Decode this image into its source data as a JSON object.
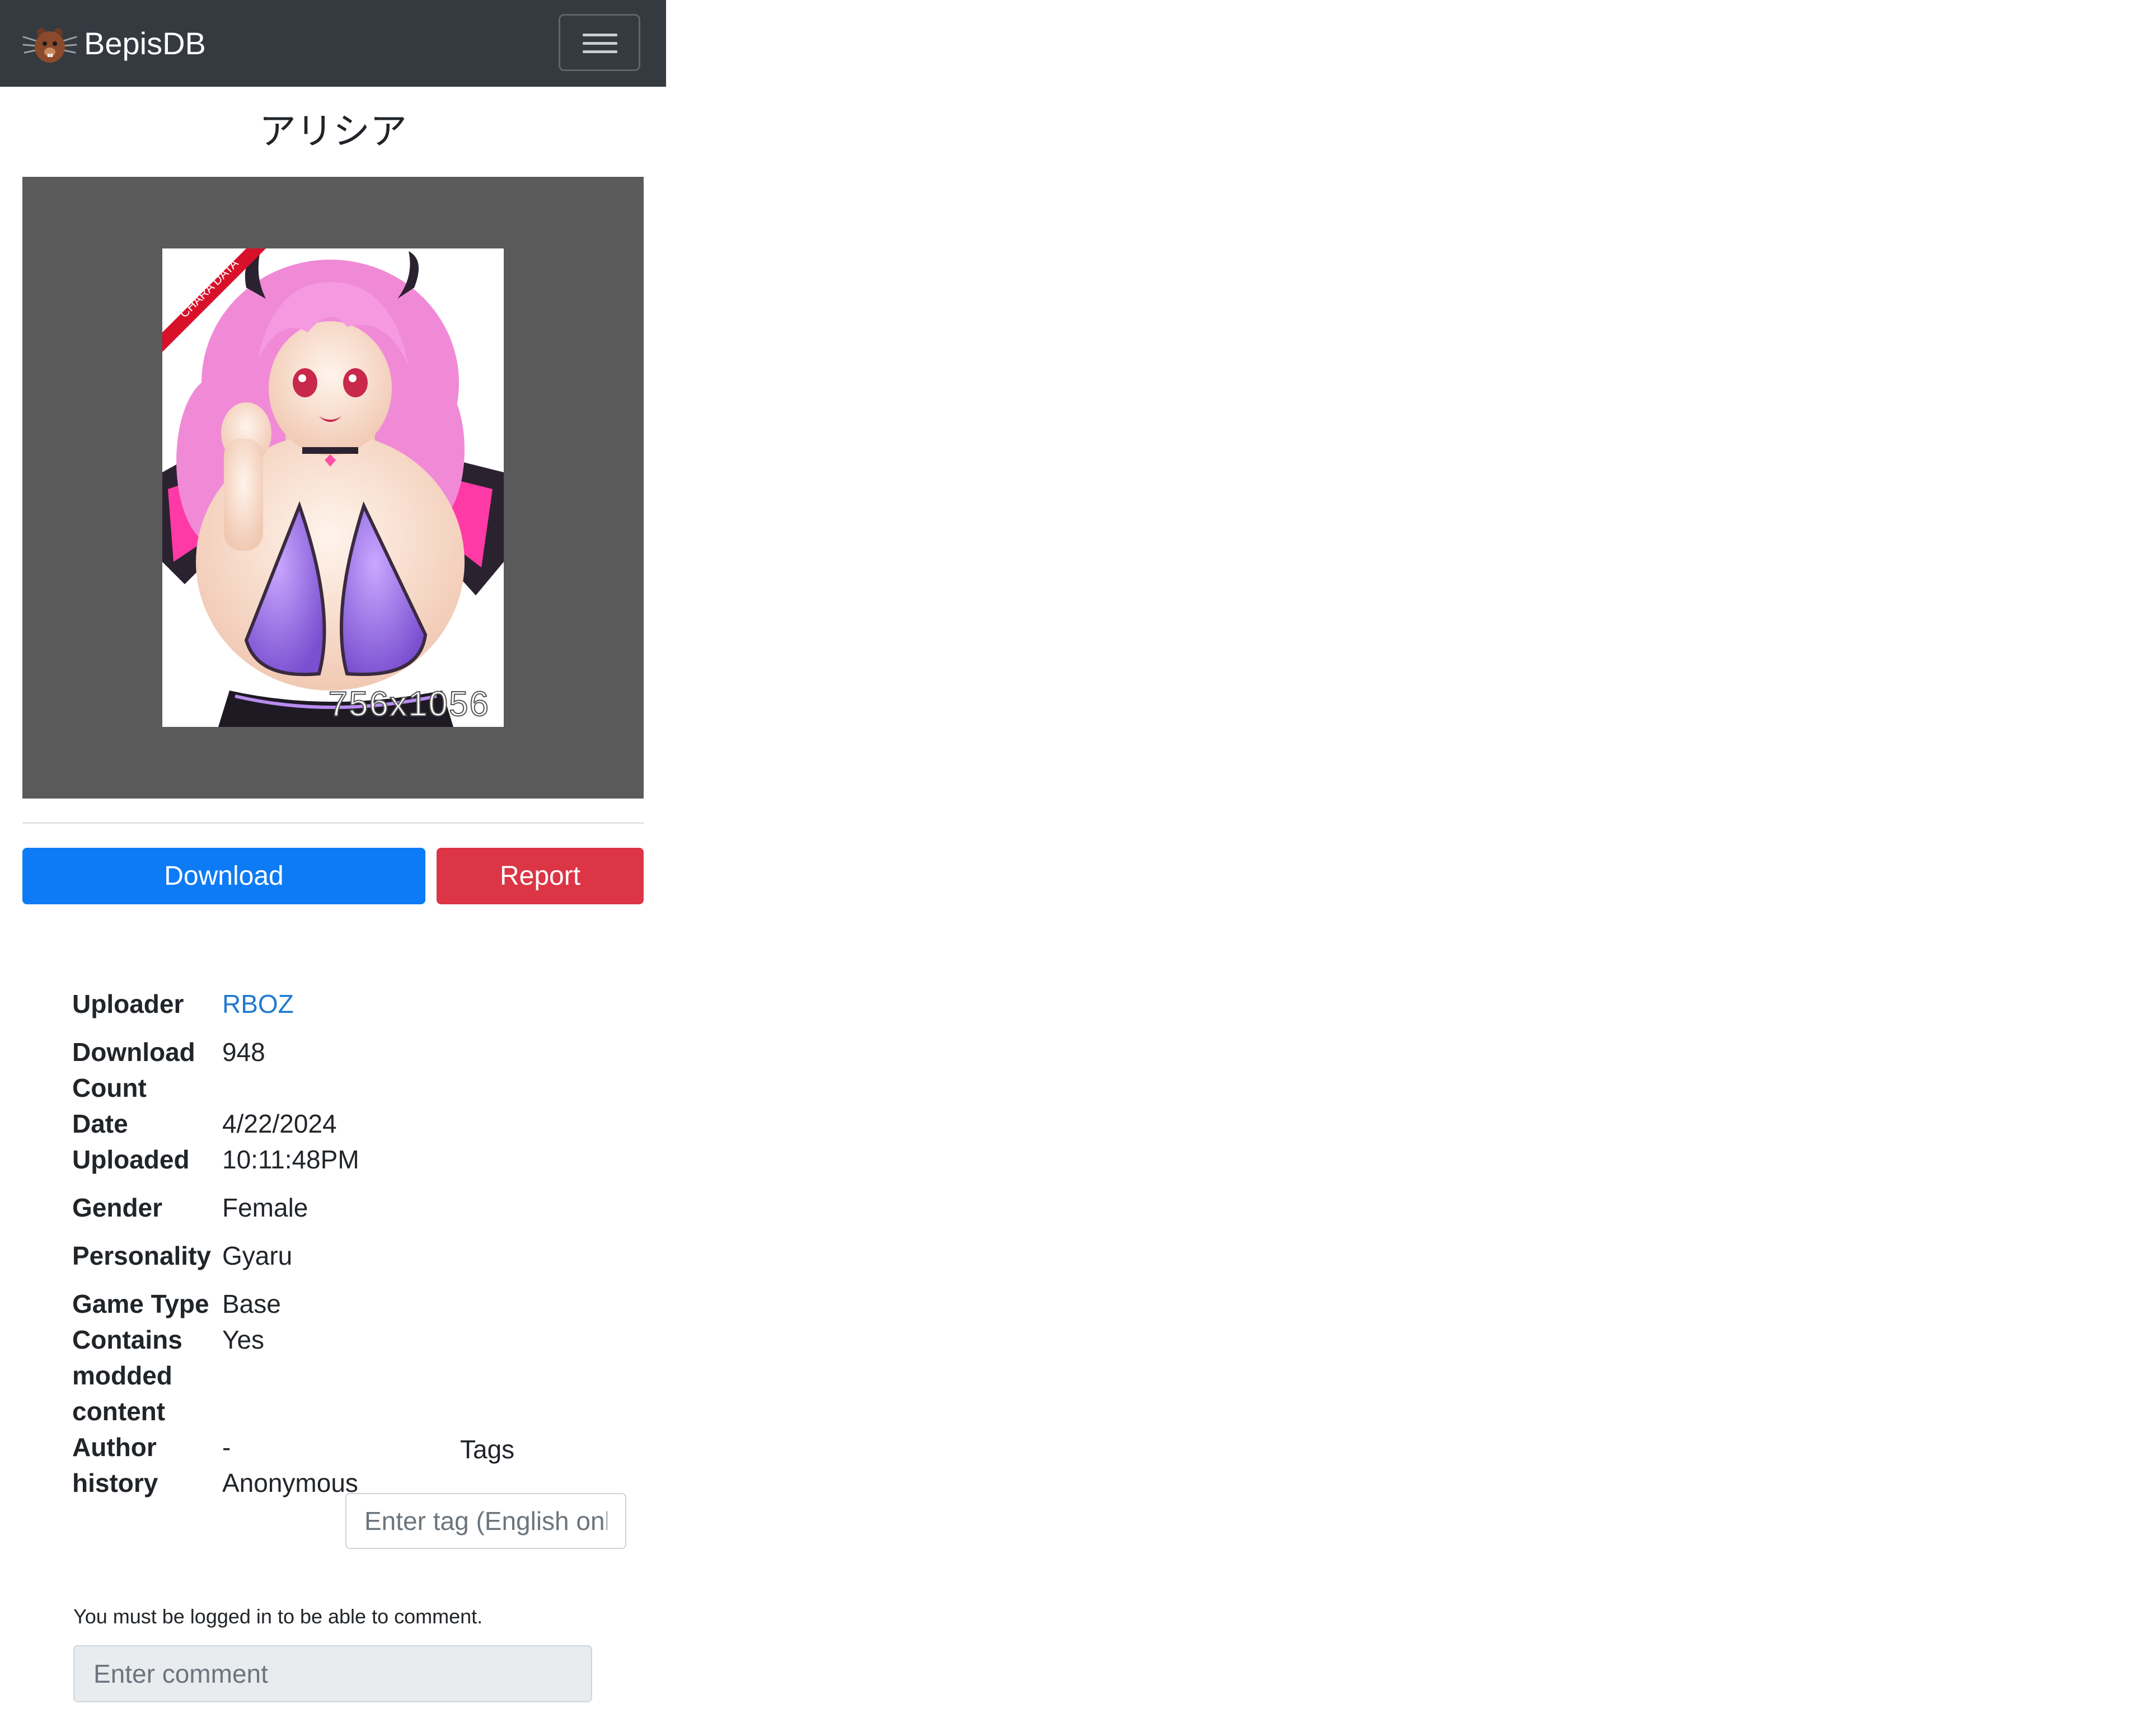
{
  "navbar": {
    "brand": "BepisDB",
    "logo_icon": "bepis-logo-icon",
    "menu_icon": "hamburger-menu-icon"
  },
  "card": {
    "title": "アリシア",
    "preview_overlay": "756x1056",
    "preview_ribbon": "CHARA DATA"
  },
  "actions": {
    "download_label": "Download",
    "report_label": "Report"
  },
  "info": {
    "uploader_label": "Uploader",
    "uploader_value": "RBOZ",
    "download_count_label": "Download Count",
    "download_count_value": "948",
    "date_label": "Date Uploaded",
    "date_value": "4/22/2024 10:11:48PM",
    "gender_label": "Gender",
    "gender_value": "Female",
    "personality_label": "Personality",
    "personality_value": "Gyaru",
    "game_type_label": "Game Type",
    "game_type_value": "Base",
    "modded_label": "Contains modded content",
    "modded_value": "Yes",
    "author_history_label": "Author history",
    "author_history_value": "- Anonymous"
  },
  "tags": {
    "label": "Tags",
    "placeholder": "Enter tag (English only)"
  },
  "comments": {
    "login_message": "You must be logged in to be able to comment.",
    "placeholder": "Enter comment"
  },
  "colors": {
    "navbar": "#343a40",
    "download": "#0d7bf5",
    "report": "#dc3545",
    "link": "#1f7ad1",
    "preview_bg": "#5a5a5a"
  }
}
